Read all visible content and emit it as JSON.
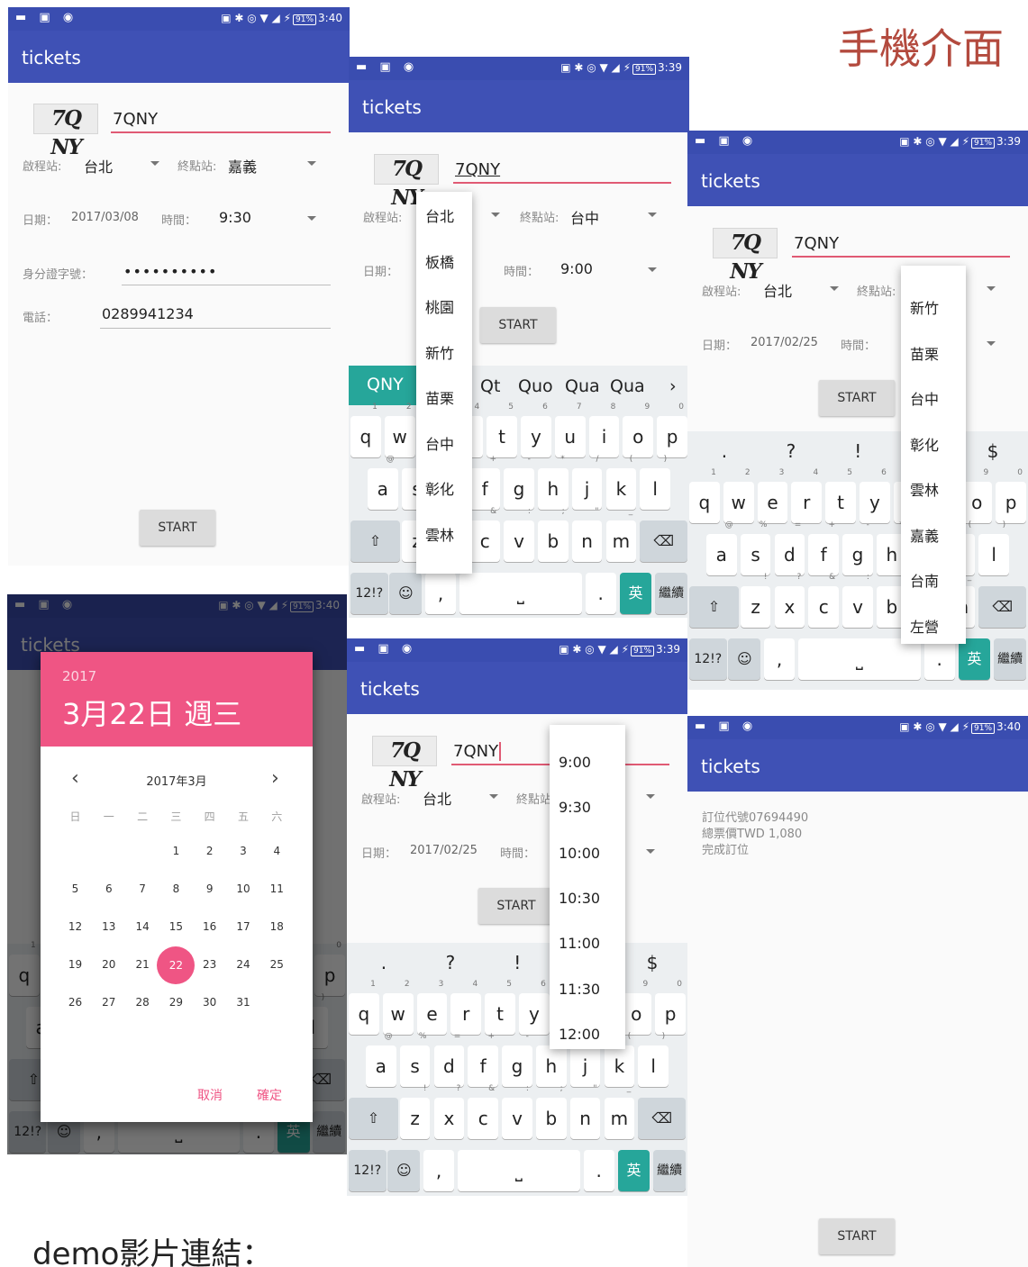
{
  "heading": "手機介面",
  "footer": "demo影片連結：",
  "status": {
    "time1": "3:40",
    "time2": "3:39",
    "battery": "91%"
  },
  "app_title": "tickets",
  "captcha": {
    "image_text": "7Q NY",
    "value": "7QNY"
  },
  "form": {
    "start_label": "啟程站:",
    "start_value": "台北",
    "end_label": "終點站:",
    "end_value1": "嘉義",
    "end_value2": "台中",
    "date_label": "日期：",
    "date_value1": "2017/03/08",
    "date_value2": "2017/02/25",
    "time_label": "時間：",
    "time_value1": "9:30",
    "time_value2": "9:00",
    "id_label": "身分證字號：",
    "id_value": "••••••••••",
    "phone_label": "電話：",
    "phone_value": "0289941234",
    "start_button": "START"
  },
  "station_dropdown1": [
    "台北",
    "板橋",
    "桃園",
    "新竹",
    "苗栗",
    "台中",
    "彰化",
    "雲林"
  ],
  "station_dropdown2": [
    "新竹",
    "苗栗",
    "台中",
    "彰化",
    "雲林",
    "嘉義",
    "台南",
    "左營"
  ],
  "time_dropdown": [
    "9:00",
    "9:30",
    "10:00",
    "10:30",
    "11:00",
    "11:30",
    "12:00"
  ],
  "suggestions": {
    "typed": "QNY",
    "s1": "Qt",
    "s2": "Quo",
    "s3": "Qua",
    "s4": "Qua"
  },
  "keyboard": {
    "row1": [
      "q",
      "w",
      "e",
      "r",
      "t",
      "y",
      "u",
      "i",
      "o",
      "p"
    ],
    "row1_hints": [
      "1",
      "2",
      "3",
      "4",
      "5",
      "6",
      "7",
      "8",
      "9",
      "0"
    ],
    "row2": [
      "a",
      "s",
      "d",
      "f",
      "g",
      "h",
      "j",
      "k",
      "l"
    ],
    "row2_hints": [
      "@",
      "%",
      "=",
      "+",
      "-",
      "*",
      "/",
      "(",
      ")"
    ],
    "row3": [
      "z",
      "x",
      "c",
      "v",
      "b",
      "n",
      "m"
    ],
    "row3_hints": [
      "!",
      "?",
      "&",
      ":",
      ";",
      "\"",
      "_"
    ],
    "sym_key": "12!?",
    "comma": ",",
    "period": ".",
    "lang_key": "英",
    "enter_key": "繼續",
    "punct": [
      ".",
      "?",
      "!",
      "$"
    ]
  },
  "calendar": {
    "year": "2017",
    "date_title": "3月22日 週三",
    "month": "2017年3月",
    "weekdays": [
      "日",
      "一",
      "二",
      "三",
      "四",
      "五",
      "六"
    ],
    "days": [
      "1",
      "2",
      "3",
      "4",
      "5",
      "6",
      "7",
      "8",
      "9",
      "10",
      "11",
      "12",
      "13",
      "14",
      "15",
      "16",
      "17",
      "18",
      "19",
      "20",
      "21",
      "22",
      "23",
      "24",
      "25",
      "26",
      "27",
      "28",
      "29",
      "30",
      "31"
    ],
    "selected": "22",
    "cancel": "取消",
    "ok": "確定"
  },
  "result": {
    "line1": "訂位代號07694490",
    "line2": "總票價TWD 1,080",
    "line3": "完成訂位"
  },
  "colors": {
    "primary": "#3f51b5",
    "status": "#3a4db0",
    "accent": "#ef5584",
    "teal": "#26a69a"
  }
}
